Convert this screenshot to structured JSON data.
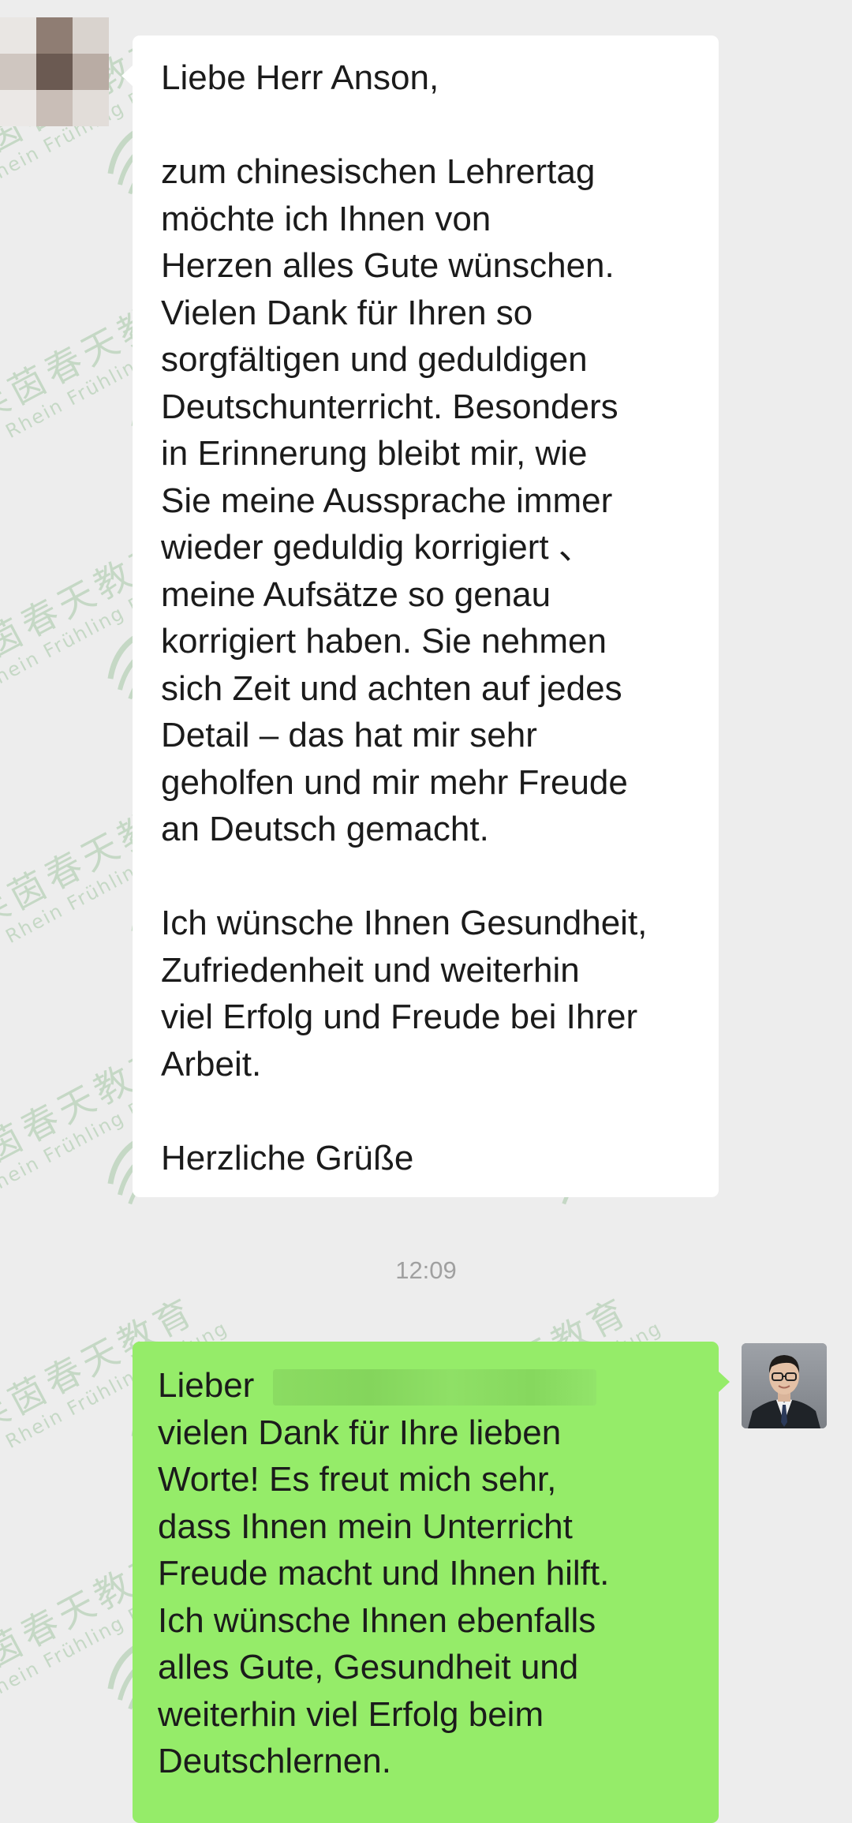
{
  "chat": {
    "incoming_message": {
      "lines": [
        "Liebe Herr Anson,",
        "",
        "zum chinesischen Lehrertag",
        "möchte ich Ihnen von",
        "Herzen alles Gute wünschen.",
        "Vielen Dank für Ihren so",
        "sorgfältigen und geduldigen",
        "Deutschunterricht. Besonders",
        "in Erinnerung bleibt mir, wie",
        "Sie  meine Aussprache immer",
        "wieder geduldig korrigiert 、",
        "meine Aufsätze so genau",
        "korrigiert haben. Sie nehmen",
        "sich Zeit und achten auf jedes",
        "Detail – das hat mir sehr",
        "geholfen und mir mehr Freude",
        "an Deutsch gemacht.",
        "",
        "Ich wünsche Ihnen Gesundheit,",
        "Zufriedenheit und weiterhin",
        "viel Erfolg und Freude bei Ihrer",
        "Arbeit.",
        "",
        "Herzliche Grüße"
      ]
    },
    "timestamp": "12:09",
    "outgoing_message": {
      "greeting": "Lieber",
      "lines": [
        "vielen Dank für Ihre lieben",
        "Worte! Es freut mich sehr,",
        "dass Ihnen mein Unterricht",
        "Freude macht und Ihnen hilft.",
        "Ich wünsche Ihnen ebenfalls",
        "alles Gute, Gesundheit und",
        "weiterhin viel Erfolg beim",
        "Deutschlernen."
      ]
    }
  },
  "watermark": {
    "chinese": "莱茵春天教育",
    "english": "Rhein Frühling Bildung"
  },
  "colors": {
    "background": "#ededed",
    "incoming_bubble": "#ffffff",
    "outgoing_bubble": "#95ec69",
    "timestamp_text": "#a0a0a0",
    "watermark": "#3a8f3a"
  },
  "icons": {
    "sender_avatar": "pixelated-avatar",
    "own_avatar": "person-photo-avatar"
  }
}
